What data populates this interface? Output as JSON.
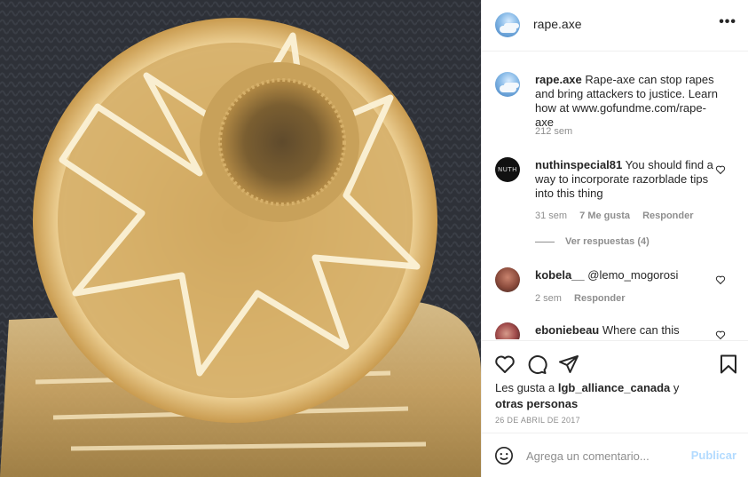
{
  "post": {
    "username": "rape.axe",
    "more_label": "•••",
    "media_alt": "close-up of a translucent amber rubber tube with inner barbs"
  },
  "comments": [
    {
      "username": "rape.axe",
      "text": "Rape-axe can stop rapes and bring attackers to justice. Learn how at www.gofundme.com/rape-axe",
      "time": "212 sem"
    },
    {
      "username": "nuthinspecial81",
      "text": "You should find a way to incorporate razorblade tips into this thing",
      "time": "31 sem",
      "likes": "7 Me gusta",
      "reply_label": "Responder",
      "view_replies": "Ver respuestas (4)"
    },
    {
      "username": "kobela__",
      "text": "@lemo_mogorosi",
      "time": "2 sem",
      "reply_label": "Responder"
    },
    {
      "username": "eboniebeau",
      "text": "Where can this"
    }
  ],
  "liked_by": {
    "prefix": "Les gusta a ",
    "user": "lgb_alliance_canada",
    "suffix": " y",
    "others": "otras personas"
  },
  "date": "26 DE ABRIL DE 2017",
  "composer": {
    "placeholder": "Agrega un comentario...",
    "publish_label": "Publicar"
  },
  "icons": [
    "heart-icon",
    "comment-icon",
    "share-icon",
    "bookmark-icon",
    "emoji-icon",
    "more-icon"
  ],
  "colors": {
    "link_blue_disabled": "#b3dbff",
    "muted": "#8e8e8e",
    "text": "#262626"
  }
}
